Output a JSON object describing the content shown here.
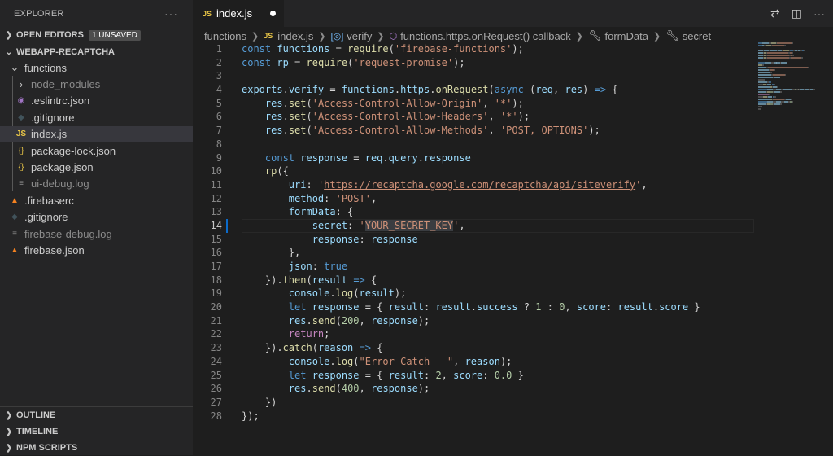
{
  "explorer": {
    "title": "EXPLORER",
    "more": "···",
    "open_editors": {
      "label": "OPEN EDITORS",
      "badge": "1 UNSAVED"
    },
    "project": {
      "label": "WEBAPP-RECAPTCHA"
    },
    "tree": [
      {
        "label": "functions",
        "icon": "chevron-down-icon",
        "glyph": "⌄",
        "indent": 1,
        "color": "#c5c5c5",
        "dim": false,
        "active": false
      },
      {
        "label": "node_modules",
        "icon": "chevron-right-icon",
        "glyph": "›",
        "indent": 2,
        "color": "#c5c5c5",
        "dim": true,
        "active": false
      },
      {
        "label": ".eslintrc.json",
        "icon": "eslint-icon",
        "glyph": "◉",
        "indent": 2,
        "color": "#a074c4",
        "dim": false,
        "active": false
      },
      {
        "label": ".gitignore",
        "icon": "git-icon",
        "glyph": "◆",
        "indent": 2,
        "color": "#41535b",
        "dim": false,
        "active": false
      },
      {
        "label": "index.js",
        "icon": "javascript-icon",
        "glyph": "JS",
        "indent": 2,
        "color": "#e8c547",
        "dim": false,
        "active": true
      },
      {
        "label": "package-lock.json",
        "icon": "json-icon",
        "glyph": "{}",
        "indent": 2,
        "color": "#e8c547",
        "dim": false,
        "active": false
      },
      {
        "label": "package.json",
        "icon": "json-icon",
        "glyph": "{}",
        "indent": 2,
        "color": "#e8c547",
        "dim": false,
        "active": false
      },
      {
        "label": "ui-debug.log",
        "icon": "log-icon",
        "glyph": "≡",
        "indent": 2,
        "color": "#8c8c8c",
        "dim": true,
        "active": false
      },
      {
        "label": ".firebaserc",
        "icon": "firebase-icon",
        "glyph": "▲",
        "indent": 1,
        "color": "#f58220",
        "dim": false,
        "active": false
      },
      {
        "label": ".gitignore",
        "icon": "git-icon",
        "glyph": "◆",
        "indent": 1,
        "color": "#41535b",
        "dim": false,
        "active": false
      },
      {
        "label": "firebase-debug.log",
        "icon": "log-icon",
        "glyph": "≡",
        "indent": 1,
        "color": "#8c8c8c",
        "dim": true,
        "active": false
      },
      {
        "label": "firebase.json",
        "icon": "firebase-icon",
        "glyph": "▲",
        "indent": 1,
        "color": "#f58220",
        "dim": false,
        "active": false
      }
    ],
    "bottom_sections": [
      "OUTLINE",
      "TIMELINE",
      "NPM SCRIPTS"
    ]
  },
  "tab": {
    "badge": "JS",
    "filename": "index.js"
  },
  "breadcrumbs": [
    "functions",
    "index.js",
    "verify",
    "functions.https.onRequest() callback",
    "formData",
    "secret"
  ],
  "current_line": 14,
  "code": [
    [
      [
        "const ",
        "k"
      ],
      [
        "functions",
        "v"
      ],
      [
        " = ",
        "p"
      ],
      [
        "require",
        "f"
      ],
      [
        "(",
        "p"
      ],
      [
        "'firebase-functions'",
        "s"
      ],
      [
        ");",
        "p"
      ]
    ],
    [
      [
        "const ",
        "k"
      ],
      [
        "rp",
        "v"
      ],
      [
        " = ",
        "p"
      ],
      [
        "require",
        "f"
      ],
      [
        "(",
        "p"
      ],
      [
        "'request-promise'",
        "s"
      ],
      [
        ");",
        "p"
      ]
    ],
    [],
    [
      [
        "exports",
        "v"
      ],
      [
        ".",
        "p"
      ],
      [
        "verify",
        "v"
      ],
      [
        " = ",
        "p"
      ],
      [
        "functions",
        "v"
      ],
      [
        ".",
        "p"
      ],
      [
        "https",
        "v"
      ],
      [
        ".",
        "p"
      ],
      [
        "onRequest",
        "f"
      ],
      [
        "(",
        "p"
      ],
      [
        "async",
        "k"
      ],
      [
        " (",
        "p"
      ],
      [
        "req",
        "v"
      ],
      [
        ", ",
        "p"
      ],
      [
        "res",
        "v"
      ],
      [
        ") ",
        "p"
      ],
      [
        "=>",
        "k"
      ],
      [
        " {",
        "p"
      ]
    ],
    [
      [
        "    res",
        "v"
      ],
      [
        ".",
        "p"
      ],
      [
        "set",
        "f"
      ],
      [
        "(",
        "p"
      ],
      [
        "'Access-Control-Allow-Origin'",
        "s"
      ],
      [
        ", ",
        "p"
      ],
      [
        "'*'",
        "s"
      ],
      [
        ");",
        "p"
      ]
    ],
    [
      [
        "    res",
        "v"
      ],
      [
        ".",
        "p"
      ],
      [
        "set",
        "f"
      ],
      [
        "(",
        "p"
      ],
      [
        "'Access-Control-Allow-Headers'",
        "s"
      ],
      [
        ", ",
        "p"
      ],
      [
        "'*'",
        "s"
      ],
      [
        ");",
        "p"
      ]
    ],
    [
      [
        "    res",
        "v"
      ],
      [
        ".",
        "p"
      ],
      [
        "set",
        "f"
      ],
      [
        "(",
        "p"
      ],
      [
        "'Access-Control-Allow-Methods'",
        "s"
      ],
      [
        ", ",
        "p"
      ],
      [
        "'POST, OPTIONS'",
        "s"
      ],
      [
        ");",
        "p"
      ]
    ],
    [],
    [
      [
        "    const ",
        "k"
      ],
      [
        "response",
        "v"
      ],
      [
        " = ",
        "p"
      ],
      [
        "req",
        "v"
      ],
      [
        ".",
        "p"
      ],
      [
        "query",
        "v"
      ],
      [
        ".",
        "p"
      ],
      [
        "response",
        "v"
      ]
    ],
    [
      [
        "    rp",
        "f"
      ],
      [
        "({",
        "p"
      ]
    ],
    [
      [
        "        uri",
        "v"
      ],
      [
        ": ",
        "p"
      ],
      [
        "'",
        "s"
      ],
      [
        "https://recaptcha.google.com/recaptcha/api/siteverify",
        "u"
      ],
      [
        "'",
        "s"
      ],
      [
        ",",
        "p"
      ]
    ],
    [
      [
        "        method",
        "v"
      ],
      [
        ": ",
        "p"
      ],
      [
        "'POST'",
        "s"
      ],
      [
        ",",
        "p"
      ]
    ],
    [
      [
        "        formData",
        "v"
      ],
      [
        ": ",
        "p"
      ],
      [
        "{",
        "p"
      ]
    ],
    [
      [
        "            secret",
        "v"
      ],
      [
        ": ",
        "p"
      ],
      [
        "'",
        "s"
      ],
      [
        "YOUR_SECRET_KEY",
        "s hl"
      ],
      [
        "'",
        "s"
      ],
      [
        ",",
        "p"
      ]
    ],
    [
      [
        "            response",
        "v"
      ],
      [
        ": ",
        "p"
      ],
      [
        "response",
        "v"
      ]
    ],
    [
      [
        "        },",
        "p"
      ]
    ],
    [
      [
        "        json",
        "v"
      ],
      [
        ": ",
        "p"
      ],
      [
        "true",
        "k"
      ]
    ],
    [
      [
        "    }).",
        "p"
      ],
      [
        "then",
        "f"
      ],
      [
        "(",
        "p"
      ],
      [
        "result",
        "v"
      ],
      [
        " ",
        "p"
      ],
      [
        "=>",
        "k"
      ],
      [
        " {",
        "p"
      ]
    ],
    [
      [
        "        console",
        "v"
      ],
      [
        ".",
        "p"
      ],
      [
        "log",
        "f"
      ],
      [
        "(",
        "p"
      ],
      [
        "result",
        "v"
      ],
      [
        ");",
        "p"
      ]
    ],
    [
      [
        "        let ",
        "k"
      ],
      [
        "response",
        "v"
      ],
      [
        " = { ",
        "p"
      ],
      [
        "result",
        "v"
      ],
      [
        ": ",
        "p"
      ],
      [
        "result",
        "v"
      ],
      [
        ".",
        "p"
      ],
      [
        "success",
        "v"
      ],
      [
        " ? ",
        "p"
      ],
      [
        "1",
        "n"
      ],
      [
        " : ",
        "p"
      ],
      [
        "0",
        "n"
      ],
      [
        ", ",
        "p"
      ],
      [
        "score",
        "v"
      ],
      [
        ": ",
        "p"
      ],
      [
        "result",
        "v"
      ],
      [
        ".",
        "p"
      ],
      [
        "score",
        "v"
      ],
      [
        " }",
        "p"
      ]
    ],
    [
      [
        "        res",
        "v"
      ],
      [
        ".",
        "p"
      ],
      [
        "send",
        "f"
      ],
      [
        "(",
        "p"
      ],
      [
        "200",
        "n"
      ],
      [
        ", ",
        "p"
      ],
      [
        "response",
        "v"
      ],
      [
        ");",
        "p"
      ]
    ],
    [
      [
        "        return",
        "kc"
      ],
      [
        ";",
        "p"
      ]
    ],
    [
      [
        "    }).",
        "p"
      ],
      [
        "catch",
        "f"
      ],
      [
        "(",
        "p"
      ],
      [
        "reason",
        "v"
      ],
      [
        " ",
        "p"
      ],
      [
        "=>",
        "k"
      ],
      [
        " {",
        "p"
      ]
    ],
    [
      [
        "        console",
        "v"
      ],
      [
        ".",
        "p"
      ],
      [
        "log",
        "f"
      ],
      [
        "(",
        "p"
      ],
      [
        "\"Error Catch - \"",
        "s"
      ],
      [
        ", ",
        "p"
      ],
      [
        "reason",
        "v"
      ],
      [
        ");",
        "p"
      ]
    ],
    [
      [
        "        let ",
        "k"
      ],
      [
        "response",
        "v"
      ],
      [
        " = { ",
        "p"
      ],
      [
        "result",
        "v"
      ],
      [
        ": ",
        "p"
      ],
      [
        "2",
        "n"
      ],
      [
        ", ",
        "p"
      ],
      [
        "score",
        "v"
      ],
      [
        ": ",
        "p"
      ],
      [
        "0.0",
        "n"
      ],
      [
        " }",
        "p"
      ]
    ],
    [
      [
        "        res",
        "v"
      ],
      [
        ".",
        "p"
      ],
      [
        "send",
        "f"
      ],
      [
        "(",
        "p"
      ],
      [
        "400",
        "n"
      ],
      [
        ", ",
        "p"
      ],
      [
        "response",
        "v"
      ],
      [
        ");",
        "p"
      ]
    ],
    [
      [
        "    })",
        "p"
      ]
    ],
    [
      [
        "});",
        "p"
      ]
    ]
  ]
}
